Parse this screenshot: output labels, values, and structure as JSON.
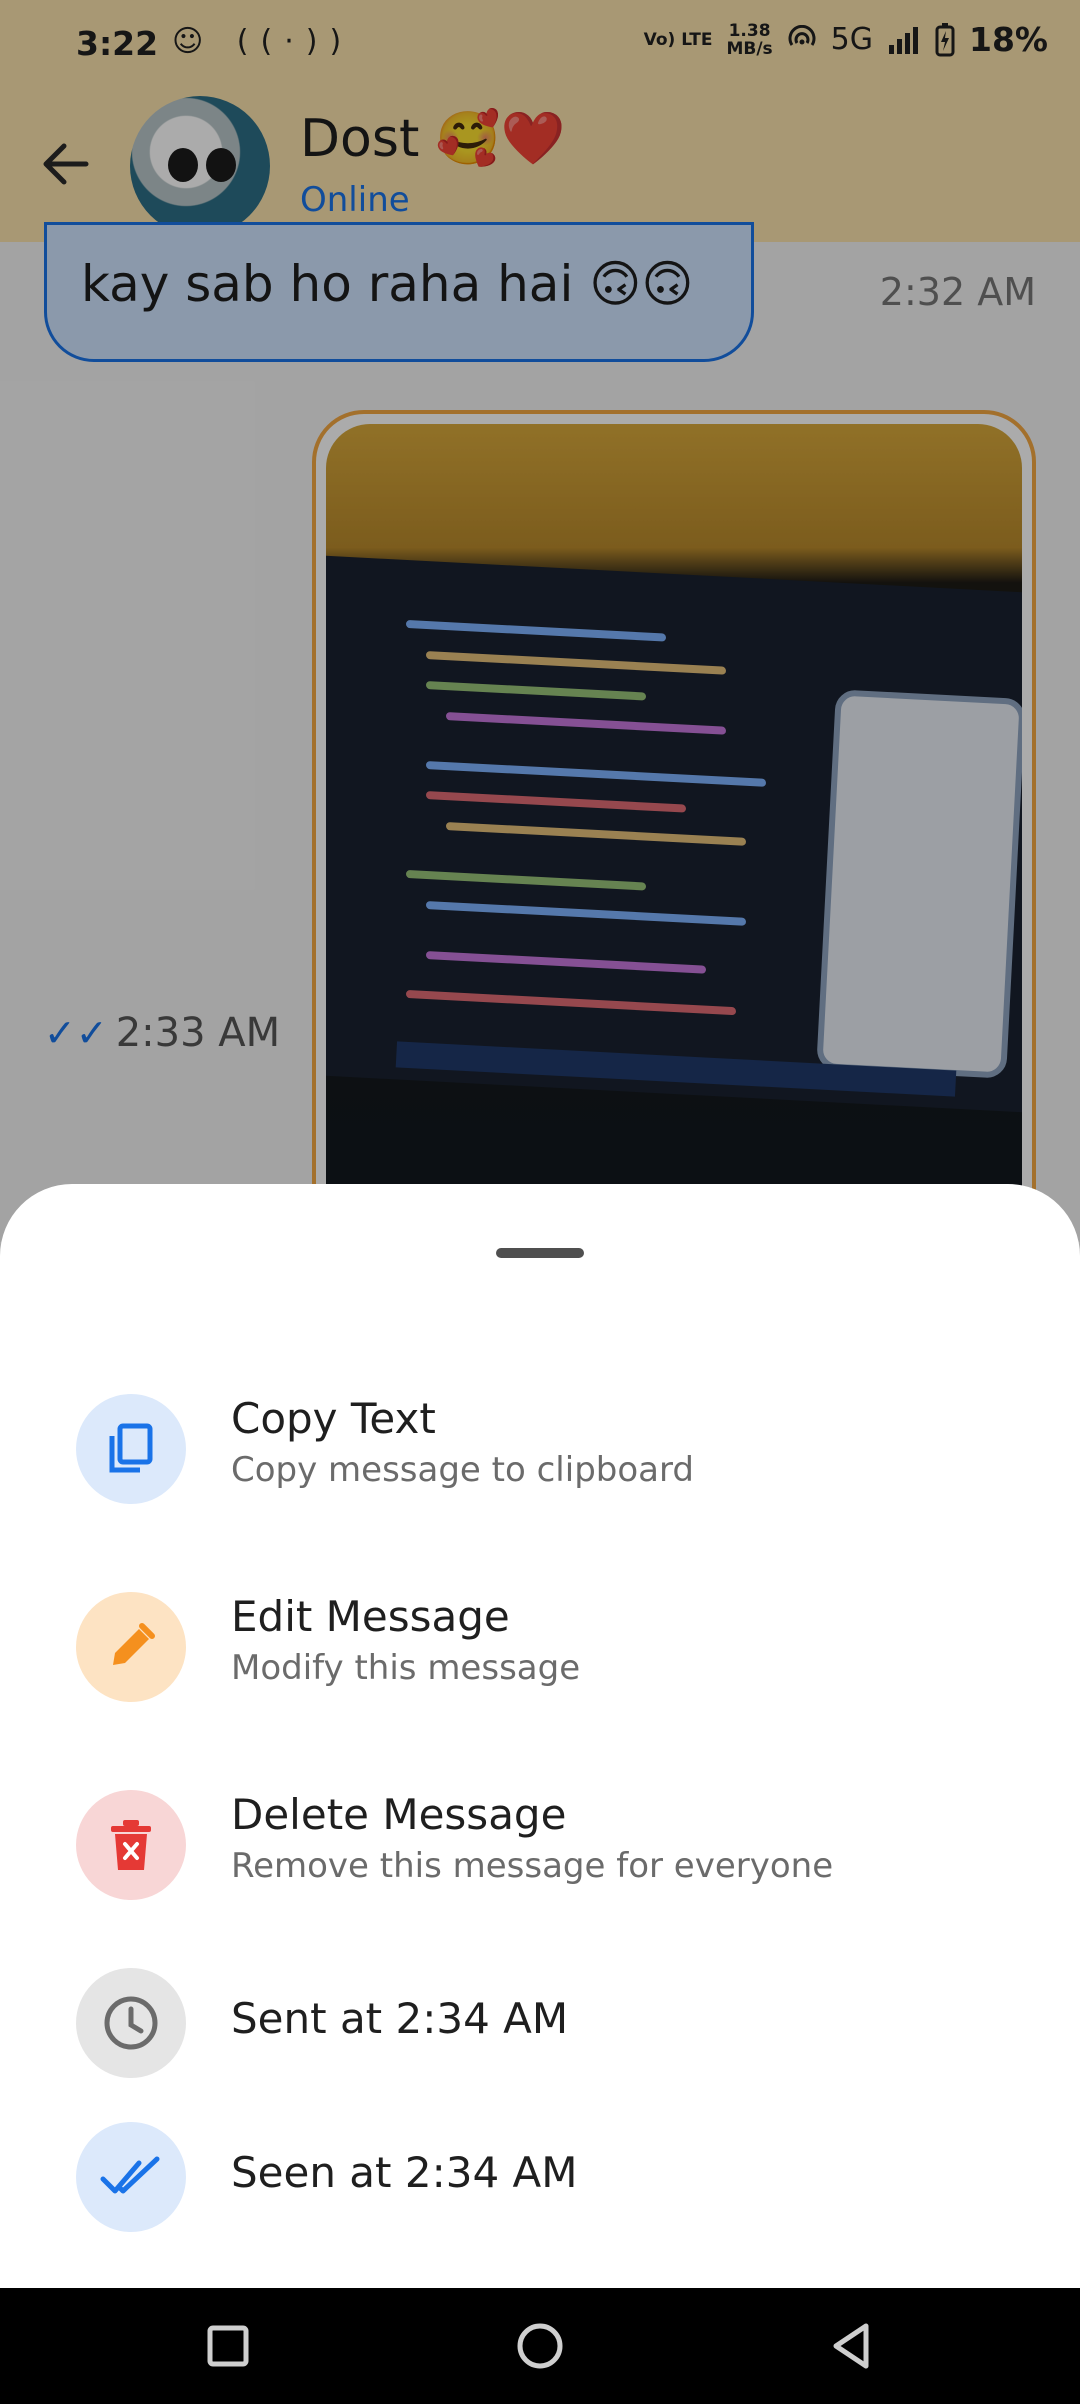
{
  "status_bar": {
    "time": "3:22",
    "app_icons": "☺ ((·))",
    "network_label": "Vo) LTE",
    "speed_value": "1.38",
    "speed_unit": "MB/s",
    "net_type": "5G",
    "battery": "18%"
  },
  "header": {
    "contact_name": "Dost 🥰❤️",
    "status": "Online"
  },
  "chat": {
    "incoming_text": "kay sab ho raha hai 🙃🙃",
    "incoming_time": "2:32 AM",
    "image_time": "2:33 AM"
  },
  "sheet": {
    "options": [
      {
        "title": "Copy Text",
        "subtitle": "Copy message to clipboard",
        "icon": "copy-icon",
        "color": "#1a73e8"
      },
      {
        "title": "Edit Message",
        "subtitle": "Modify this message",
        "icon": "pencil-icon",
        "color": "#f5901e"
      },
      {
        "title": "Delete Message",
        "subtitle": "Remove this message for everyone",
        "icon": "trash-icon",
        "color": "#e53935"
      },
      {
        "title": "Sent at 2:34 AM",
        "icon": "clock-icon",
        "color": "#6b6b6b"
      },
      {
        "title": "Seen at 2:34 AM",
        "icon": "double-check-icon",
        "color": "#1a73e8"
      }
    ]
  },
  "colors": {
    "accent": "#1a73e8",
    "header_bg": "#fbe3ae",
    "image_border": "#f4a742"
  }
}
